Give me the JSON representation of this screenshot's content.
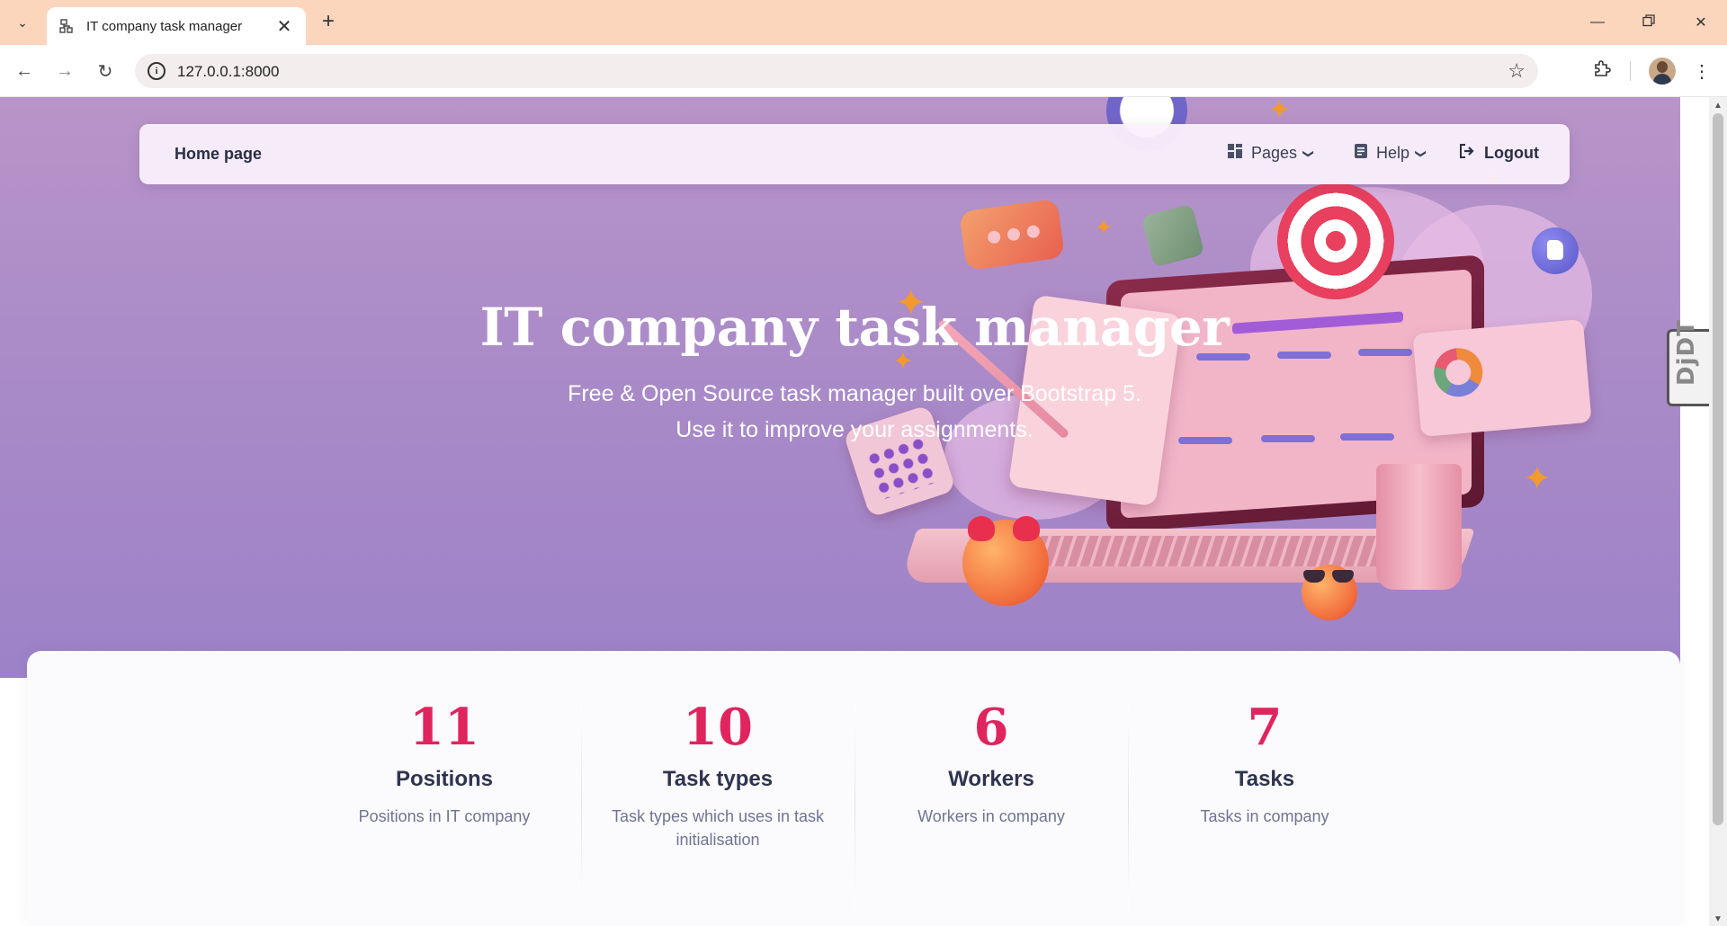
{
  "browser": {
    "tab_title": "IT company task manager",
    "url": "127.0.0.1:8000",
    "icons": {
      "tab_search": "chevron-down-icon",
      "favicon": "sitemap-icon",
      "close": "close-icon",
      "new_tab": "plus-icon",
      "minimize": "minimize-icon",
      "restore": "restore-icon",
      "window_close": "close-icon",
      "back": "arrow-left-icon",
      "forward": "arrow-right-icon",
      "reload": "reload-icon",
      "site_info": "info-icon",
      "bookmark": "star-icon",
      "extensions": "puzzle-icon",
      "menu": "more-vertical-icon"
    }
  },
  "navbar": {
    "brand": "Home page",
    "items": [
      {
        "label": "Pages",
        "icon": "grid-icon",
        "has_dropdown": true
      },
      {
        "label": "Help",
        "icon": "document-icon",
        "has_dropdown": true
      },
      {
        "label": "Logout",
        "icon": "logout-icon",
        "has_dropdown": false
      }
    ]
  },
  "hero": {
    "title": "IT company task manager",
    "subtitle_line1": "Free & Open Source task manager built over Bootstrap 5.",
    "subtitle_line2": "Use it to improve your assignments."
  },
  "stats": [
    {
      "value": "11",
      "title": "Positions",
      "description": "Positions in IT company"
    },
    {
      "value": "10",
      "title": "Task types",
      "description": "Task types which uses in task initialisation"
    },
    {
      "value": "6",
      "title": "Workers",
      "description": "Workers in company"
    },
    {
      "value": "7",
      "title": "Tasks",
      "description": "Tasks in company"
    }
  ],
  "debug_toolbar": {
    "label": "DjDT"
  },
  "colors": {
    "tabbar": "#fbd6bd",
    "hero_top": "#b894c8",
    "hero_bottom": "#9d82c8",
    "stat_value": "#e0245e",
    "stat_title": "#2e3450",
    "stat_desc": "#6f7590"
  }
}
